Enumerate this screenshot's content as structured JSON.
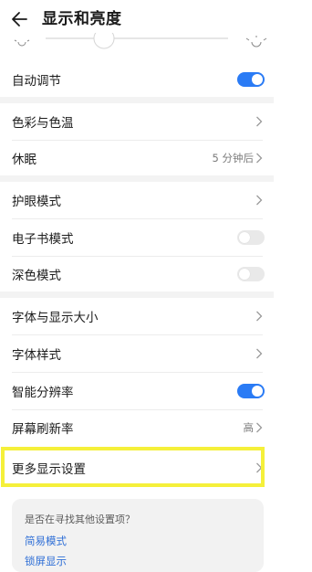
{
  "header": {
    "title": "显示和亮度"
  },
  "auto_adjust": {
    "label": "自动调节",
    "enabled": true
  },
  "color_temp": {
    "label": "色彩与色温"
  },
  "sleep": {
    "label": "休眠",
    "value": "5 分钟后"
  },
  "eye_care": {
    "label": "护眼模式"
  },
  "ebook": {
    "label": "电子书模式",
    "enabled": false
  },
  "dark": {
    "label": "深色模式",
    "enabled": false
  },
  "font_size": {
    "label": "字体与显示大小"
  },
  "font_style": {
    "label": "字体样式"
  },
  "smart_resolution": {
    "label": "智能分辨率",
    "enabled": true
  },
  "refresh_rate": {
    "label": "屏幕刷新率",
    "value": "高"
  },
  "more_settings": {
    "label": "更多显示设置"
  },
  "suggest": {
    "question": "是否在寻找其他设置项？",
    "links": [
      "简易模式",
      "锁屏显示"
    ]
  },
  "colors": {
    "accent": "#2a7bf5",
    "highlight": "#f5f03a",
    "link": "#2f6fd6"
  }
}
